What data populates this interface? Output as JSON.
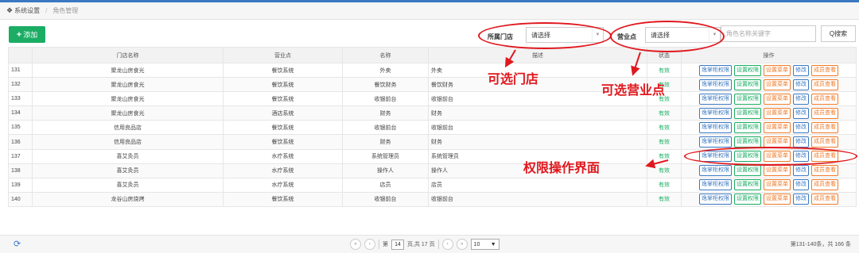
{
  "breadcrumb": {
    "home_icon": "home-icon",
    "home_label": "系统设置",
    "current": "角色管理"
  },
  "toolbar": {
    "add_label": "添加",
    "store_label": "所属门店",
    "store_select": "请选择",
    "outlet_label": "营业点",
    "outlet_select": "请选择",
    "keyword_placeholder": "角色名称关键字",
    "search_label": "Q搜索"
  },
  "annotations": {
    "store": "可选门店",
    "outlet": "可选营业点",
    "ops": "权限操作界面"
  },
  "table": {
    "headers": [
      "",
      "门店名称",
      "营业点",
      "名称",
      "描述",
      "状态",
      "操作"
    ],
    "op_labels": [
      "逸掌柜权限",
      "设置权限",
      "设置菜单",
      "修改",
      "成员查看"
    ],
    "rows": [
      [
        "131",
        "聚龙山房食光",
        "餐饮系统",
        "外卖",
        "外卖",
        "有效"
      ],
      [
        "132",
        "聚龙山房食光",
        "餐饮系统",
        "餐饮财务",
        "餐饮财务",
        "有效"
      ],
      [
        "133",
        "聚龙山房食光",
        "餐饮系统",
        "收银前台",
        "收银前台",
        "有效"
      ],
      [
        "134",
        "聚龙山房食光",
        "酒店系统",
        "财务",
        "财务",
        "有效"
      ],
      [
        "135",
        "信用良品店",
        "餐饮系统",
        "收银前台",
        "收银前台",
        "有效"
      ],
      [
        "136",
        "信用良品店",
        "餐饮系统",
        "财务",
        "财务",
        "有效"
      ],
      [
        "137",
        "喜艾灸员",
        "水疗系统",
        "系统管理员",
        "系统管理员",
        "有效"
      ],
      [
        "138",
        "喜艾灸员",
        "水疗系统",
        "操作人",
        "操作人",
        "有效"
      ],
      [
        "139",
        "喜艾灸员",
        "水疗系统",
        "店员",
        "店员",
        "有效"
      ],
      [
        "140",
        "龙谷山房烧烤",
        "餐饮系统",
        "收银前台",
        "收银前台",
        "有效"
      ]
    ]
  },
  "pager": {
    "page_prefix": "第",
    "current_page": "14",
    "page_suffix": "页,共 17 页",
    "page_size": "10",
    "info": "第131-140条，共 166 条"
  },
  "colors": {
    "accent": "#3a78c3",
    "primary_green": "#1aad63",
    "annotation_red": "#e0181e",
    "orange": "#f07a28"
  }
}
